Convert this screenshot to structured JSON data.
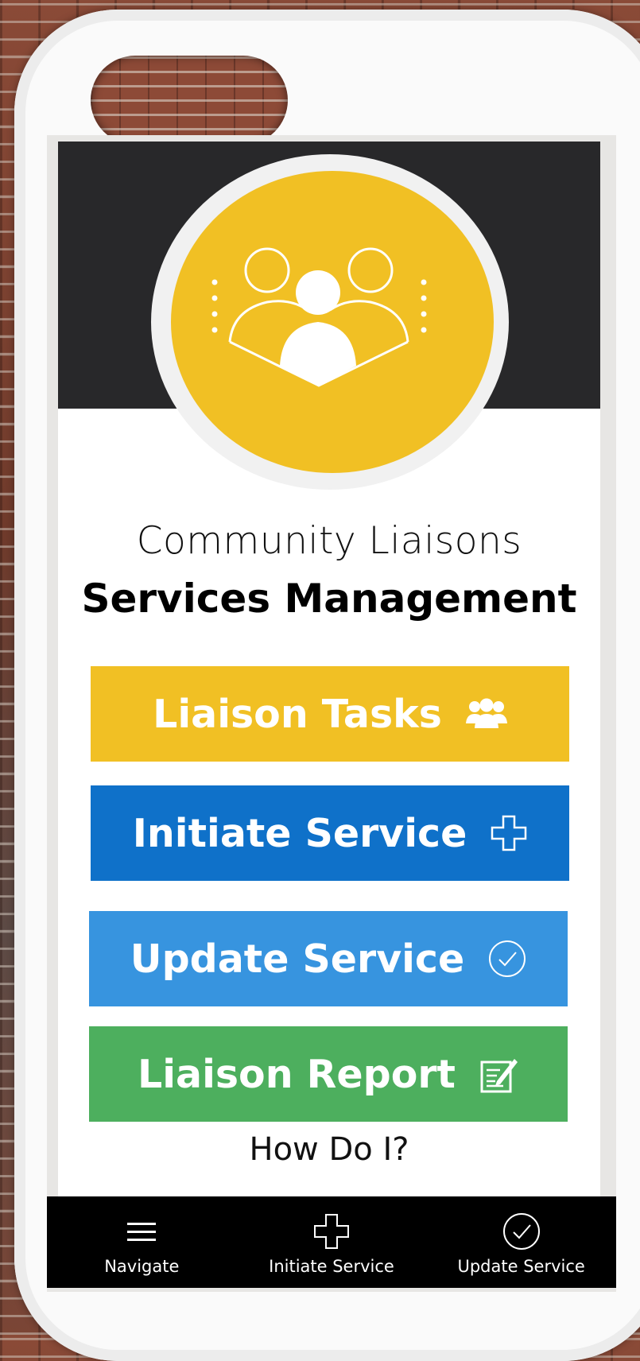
{
  "app": {
    "title_line1": "Community Liaisons",
    "title_line2": "Services Management",
    "logo_icon": "people-group-icon"
  },
  "buttons": [
    {
      "label": "Liaison Tasks",
      "icon": "users-icon",
      "color": "#f1c024"
    },
    {
      "label": "Initiate Service",
      "icon": "plus-icon",
      "color": "#0f71c9"
    },
    {
      "label": "Update Service",
      "icon": "check-circle-icon",
      "color": "#3794df"
    },
    {
      "label": "Liaison Report",
      "icon": "edit-report-icon",
      "color": "#4daf5e"
    }
  ],
  "help_link": "How Do I?",
  "tabbar": [
    {
      "label": "Navigate",
      "icon": "menu-icon"
    },
    {
      "label": "Initiate Service",
      "icon": "plus-icon"
    },
    {
      "label": "Update Service",
      "icon": "check-circle-icon"
    }
  ],
  "colors": {
    "header": "#28282a",
    "brand_yellow": "#f1c024",
    "tabbar": "#000000"
  }
}
